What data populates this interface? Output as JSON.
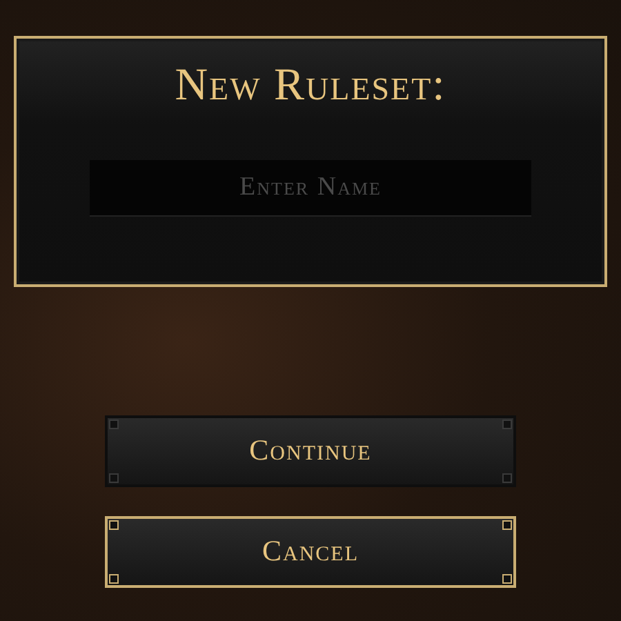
{
  "dialog": {
    "title": "New Ruleset:",
    "name_field": {
      "placeholder": "Enter Name"
    }
  },
  "buttons": [
    {
      "label": "Continue",
      "selected": false
    },
    {
      "label": "Cancel",
      "selected": true
    }
  ]
}
